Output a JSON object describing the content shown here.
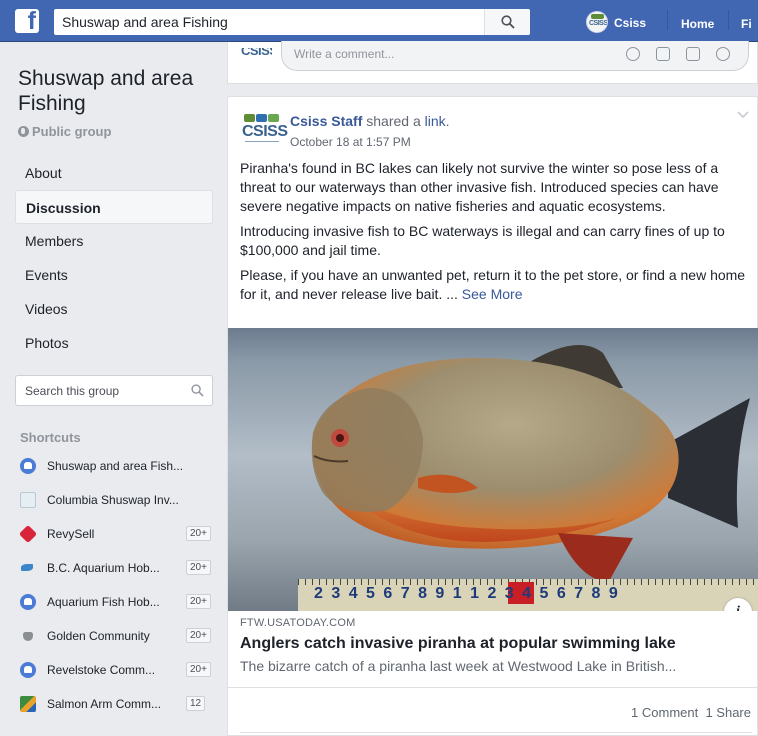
{
  "topbar": {
    "logo": "f",
    "search_value": "Shuswap and area Fishing",
    "user_name": "Csiss",
    "avatar_text": "CSISS",
    "home_label": "Home",
    "find_label": "Fi"
  },
  "group": {
    "name": "Shuswap and area Fishing",
    "privacy": "Public group"
  },
  "menu": [
    {
      "label": "About",
      "active": false
    },
    {
      "label": "Discussion",
      "active": true
    },
    {
      "label": "Members",
      "active": false
    },
    {
      "label": "Events",
      "active": false
    },
    {
      "label": "Videos",
      "active": false
    },
    {
      "label": "Photos",
      "active": false
    }
  ],
  "side_search": {
    "placeholder": "Search this group"
  },
  "shortcuts": {
    "title": "Shortcuts",
    "items": [
      {
        "label": "Shuswap and area Fish...",
        "icon": "group-icon",
        "badge": ""
      },
      {
        "label": "Columbia Shuswap Inv...",
        "icon": "page-icon",
        "badge": ""
      },
      {
        "label": "RevySell",
        "icon": "cube-icon",
        "badge": "20+"
      },
      {
        "label": "B.C. Aquarium Hob...",
        "icon": "bird-icon",
        "badge": "20+"
      },
      {
        "label": "Aquarium Fish Hob...",
        "icon": "group-icon",
        "badge": "20+"
      },
      {
        "label": "Golden Community",
        "icon": "deer-icon",
        "badge": "20+"
      },
      {
        "label": "Revelstoke Comm...",
        "icon": "group-icon",
        "badge": "20+"
      },
      {
        "label": "Salmon Arm Comm...",
        "icon": "photo-icon",
        "badge": "12"
      }
    ]
  },
  "composer": {
    "avatar_text": "CSISS",
    "placeholder": "Write a comment..."
  },
  "post": {
    "avatar_text": "CSISS",
    "author": "Csiss Staff",
    "action": " shared a ",
    "link_word": "link",
    "period": ".",
    "time": "October 18 at 1:57 PM",
    "paragraphs": [
      "Piranha's found in BC lakes can likely not survive the winter so pose less of a threat to our waterways than other invasive fish. Introduced species can have severe negative impacts on native fisheries and aquatic ecosystems.",
      "Introducing invasive fish to BC waterways is illegal and can carry fines of up to $100,000 and jail time.",
      "Please, if you have an unwanted pet, return it to the pet store, or find a new home for it, and never release live bait. ..."
    ],
    "see_more": "See More",
    "ruler_numbers": "2 3 4 5 6 7 8 9 1 1 2 3 4 5 6 7 8 9",
    "info": "i",
    "link_preview": {
      "domain": "FTW.USATODAY.COM",
      "title": "Anglers catch invasive piranha at popular swimming lake",
      "description": "The bizarre catch of a piranha last week at Westwood Lake in British..."
    },
    "engagement": "1 Comment  1 Share"
  },
  "colors": {
    "brand": "#4267b2",
    "link": "#385898",
    "background": "#e9ebee"
  }
}
